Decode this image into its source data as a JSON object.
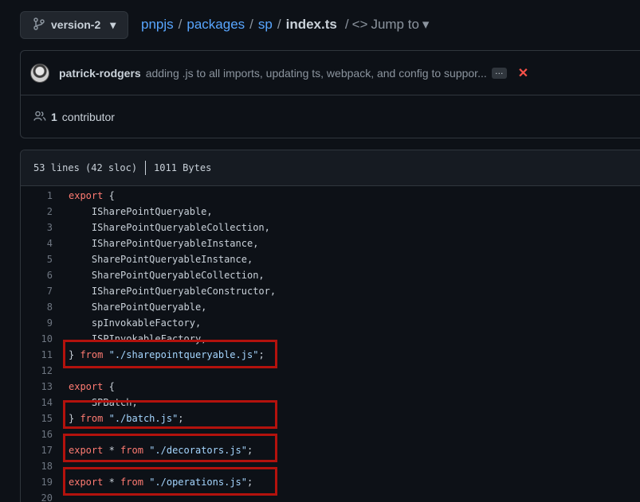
{
  "branch": {
    "label": "version-2",
    "icon": "git-branch-icon",
    "caret": "▾"
  },
  "breadcrumb": {
    "repo": "pnpjs",
    "parts": [
      "packages",
      "sp"
    ],
    "file": "index.ts",
    "separator": "/",
    "jump_label": "Jump to",
    "jump_icon": "<>"
  },
  "commit": {
    "author": "patrick-rodgers",
    "message": "adding .js to all imports, updating ts, webpack, and config to suppor...",
    "ellipsis": "…",
    "status_icon": "✕",
    "status_color": "#f85149"
  },
  "contributors": {
    "count": "1",
    "label": "contributor"
  },
  "file": {
    "lines": "53 lines (42 sloc)",
    "size": "1011 Bytes"
  },
  "code_lines": [
    {
      "n": "1",
      "tokens": [
        {
          "t": "export",
          "c": "kw"
        },
        {
          "t": " {",
          "c": ""
        }
      ]
    },
    {
      "n": "2",
      "tokens": [
        {
          "t": "    ISharePointQueryable,",
          "c": ""
        }
      ]
    },
    {
      "n": "3",
      "tokens": [
        {
          "t": "    ISharePointQueryableCollection,",
          "c": ""
        }
      ]
    },
    {
      "n": "4",
      "tokens": [
        {
          "t": "    ISharePointQueryableInstance,",
          "c": ""
        }
      ]
    },
    {
      "n": "5",
      "tokens": [
        {
          "t": "    SharePointQueryableInstance,",
          "c": ""
        }
      ]
    },
    {
      "n": "6",
      "tokens": [
        {
          "t": "    SharePointQueryableCollection,",
          "c": ""
        }
      ]
    },
    {
      "n": "7",
      "tokens": [
        {
          "t": "    ISharePointQueryableConstructor,",
          "c": ""
        }
      ]
    },
    {
      "n": "8",
      "tokens": [
        {
          "t": "    SharePointQueryable,",
          "c": ""
        }
      ]
    },
    {
      "n": "9",
      "tokens": [
        {
          "t": "    spInvokableFactory,",
          "c": ""
        }
      ]
    },
    {
      "n": "10",
      "tokens": [
        {
          "t": "    ISPInvokableFactory,",
          "c": ""
        }
      ]
    },
    {
      "n": "11",
      "tokens": [
        {
          "t": "} ",
          "c": ""
        },
        {
          "t": "from",
          "c": "kw"
        },
        {
          "t": " ",
          "c": ""
        },
        {
          "t": "\"./sharepointqueryable.js\"",
          "c": "str"
        },
        {
          "t": ";",
          "c": ""
        }
      ]
    },
    {
      "n": "12",
      "tokens": []
    },
    {
      "n": "13",
      "tokens": [
        {
          "t": "export",
          "c": "kw"
        },
        {
          "t": " {",
          "c": ""
        }
      ]
    },
    {
      "n": "14",
      "tokens": [
        {
          "t": "    SPBatch,",
          "c": ""
        }
      ]
    },
    {
      "n": "15",
      "tokens": [
        {
          "t": "} ",
          "c": ""
        },
        {
          "t": "from",
          "c": "kw"
        },
        {
          "t": " ",
          "c": ""
        },
        {
          "t": "\"./batch.js\"",
          "c": "str"
        },
        {
          "t": ";",
          "c": ""
        }
      ]
    },
    {
      "n": "16",
      "tokens": []
    },
    {
      "n": "17",
      "tokens": [
        {
          "t": "export",
          "c": "kw"
        },
        {
          "t": " * ",
          "c": ""
        },
        {
          "t": "from",
          "c": "kw"
        },
        {
          "t": " ",
          "c": ""
        },
        {
          "t": "\"./decorators.js\"",
          "c": "str"
        },
        {
          "t": ";",
          "c": ""
        }
      ]
    },
    {
      "n": "18",
      "tokens": []
    },
    {
      "n": "19",
      "tokens": [
        {
          "t": "export",
          "c": "kw"
        },
        {
          "t": " * ",
          "c": ""
        },
        {
          "t": "from",
          "c": "kw"
        },
        {
          "t": " ",
          "c": ""
        },
        {
          "t": "\"./operations.js\"",
          "c": "str"
        },
        {
          "t": ";",
          "c": ""
        }
      ]
    },
    {
      "n": "20",
      "tokens": []
    }
  ],
  "highlight_color": "#b3120d"
}
